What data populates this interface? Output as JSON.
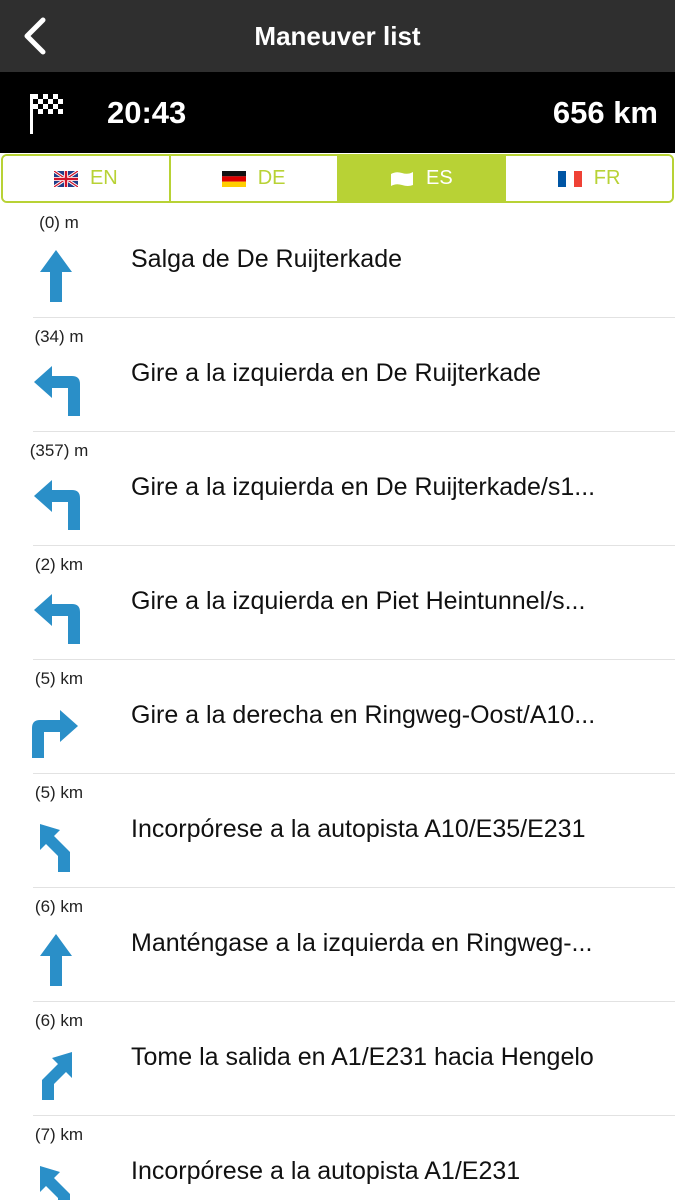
{
  "header": {
    "title": "Maneuver list",
    "back_icon": "chevron-left-icon"
  },
  "info": {
    "flag_icon": "checkered-flag-icon",
    "eta": "20:43",
    "distance": "656 km"
  },
  "languages": [
    {
      "code": "EN",
      "flag_icon": "uk-flag-icon",
      "active": false
    },
    {
      "code": "DE",
      "flag_icon": "germany-flag-icon",
      "active": false
    },
    {
      "code": "ES",
      "flag_icon": "spain-flag-icon",
      "active": true
    },
    {
      "code": "FR",
      "flag_icon": "france-flag-icon",
      "active": false
    }
  ],
  "colors": {
    "accent": "#b8d235",
    "arrow": "#2a8fc8",
    "navbar": "#2f2f2f",
    "infobar": "#000000"
  },
  "maneuvers": [
    {
      "distance": "(0) m",
      "icon": "straight-arrow-icon",
      "text": "Salga de De Ruijterkade"
    },
    {
      "distance": "(34) m",
      "icon": "turn-left-arrow-icon",
      "text": "Gire a la izquierda en De Ruijterkade"
    },
    {
      "distance": "(357) m",
      "icon": "turn-left-arrow-icon",
      "text": "Gire a la izquierda en De Ruijterkade/s1..."
    },
    {
      "distance": "(2) km",
      "icon": "turn-left-arrow-icon",
      "text": "Gire a la izquierda en Piet Heintunnel/s..."
    },
    {
      "distance": "(5) km",
      "icon": "turn-right-arrow-icon",
      "text": "Gire a la derecha en Ringweg-Oost/A10..."
    },
    {
      "distance": "(5) km",
      "icon": "slight-left-arrow-icon",
      "text": "Incorpórese a la autopista A10/E35/E231"
    },
    {
      "distance": "(6) km",
      "icon": "straight-arrow-icon",
      "text": "Manténgase a la izquierda en Ringweg-..."
    },
    {
      "distance": "(6) km",
      "icon": "slight-right-arrow-icon",
      "text": "Tome la salida en A1/E231 hacia Hengelo"
    },
    {
      "distance": "(7) km",
      "icon": "slight-left-arrow-icon",
      "text": "Incorpórese a la autopista A1/E231"
    }
  ]
}
